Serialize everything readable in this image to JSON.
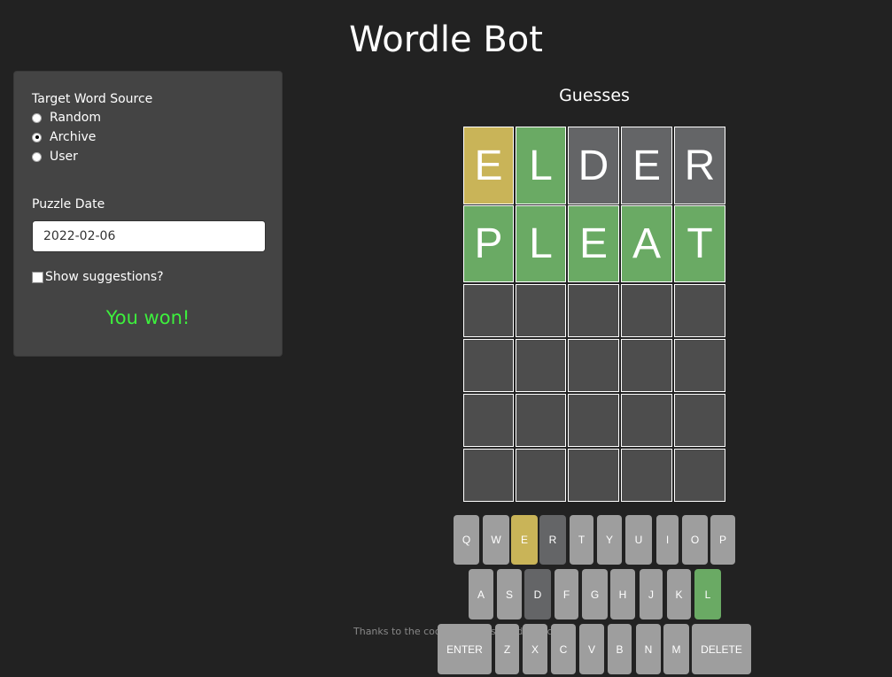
{
  "title": "Wordle Bot",
  "sidebar": {
    "source_label": "Target Word Source",
    "sources": [
      {
        "label": "Random",
        "selected": false
      },
      {
        "label": "Archive",
        "selected": true
      },
      {
        "label": "User",
        "selected": false
      }
    ],
    "date_label": "Puzzle Date",
    "date_value": "2022-02-06",
    "suggestions_label": "Show suggestions?",
    "suggestions_checked": false,
    "status": "You won!"
  },
  "board": {
    "title": "Guesses",
    "rows": 6,
    "guesses": [
      {
        "letters": [
          "E",
          "L",
          "D",
          "E",
          "R"
        ],
        "states": [
          "present",
          "correct",
          "absent",
          "absent",
          "absent"
        ]
      },
      {
        "letters": [
          "P",
          "L",
          "E",
          "A",
          "T"
        ],
        "states": [
          "correct",
          "correct",
          "correct",
          "correct",
          "correct"
        ]
      }
    ]
  },
  "keyboard": {
    "rows": [
      [
        "Q",
        "W",
        "E",
        "R",
        "T",
        "Y",
        "U",
        "I",
        "O",
        "P"
      ],
      [
        "A",
        "S",
        "D",
        "F",
        "G",
        "H",
        "J",
        "K",
        "L"
      ],
      [
        "ENTER",
        "Z",
        "X",
        "C",
        "V",
        "B",
        "N",
        "M",
        "DELETE"
      ]
    ],
    "states": {
      "E": "present",
      "R": "absent",
      "D": "absent",
      "L": "correct"
    }
  },
  "colors": {
    "correct": "#6aaa64",
    "present": "#c9b458",
    "absent": "#646567",
    "empty": "#4d4d4d",
    "key": "#9e9e9e",
    "status": "#3df03d",
    "background": "#222222",
    "panel": "#444444"
  },
  "footer": "Thanks to the coolbutuseless/wordle package"
}
